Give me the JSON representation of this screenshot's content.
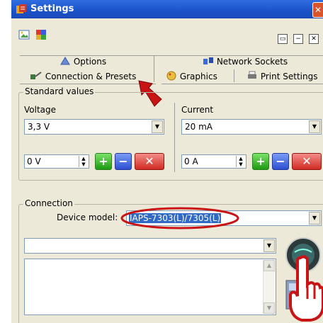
{
  "window": {
    "title": "Settings",
    "close_glyph": "✕",
    "title_color": "#1b52c9"
  },
  "tabs": {
    "row1": [
      {
        "label": "Options",
        "icon": "options-icon"
      },
      {
        "label": "Network Sockets",
        "icon": "network-sockets-icon"
      }
    ],
    "row2": [
      {
        "label": "Connection & Presets",
        "icon": "connection-icon",
        "selected": true
      },
      {
        "label": "Graphics",
        "icon": "graphics-icon"
      },
      {
        "label": "Print Settings",
        "icon": "print-icon"
      }
    ]
  },
  "standard_values": {
    "group_label": "Standard values",
    "voltage": {
      "label": "Voltage",
      "selected": "3,3 V",
      "preset_value": "0 V"
    },
    "current": {
      "label": "Current",
      "selected": "20 mA",
      "preset_value": "0 A"
    },
    "add_glyph": "+",
    "remove_glyph": "−",
    "delete_glyph": "✕"
  },
  "connection": {
    "group_label": "Connection",
    "device_model_label": "Device model:",
    "device_model_value": "IAPS-7303(L)/7305(L)",
    "second_combo_value": ""
  },
  "colors": {
    "accent": "#316ac5",
    "annotation_red": "#c81414"
  }
}
